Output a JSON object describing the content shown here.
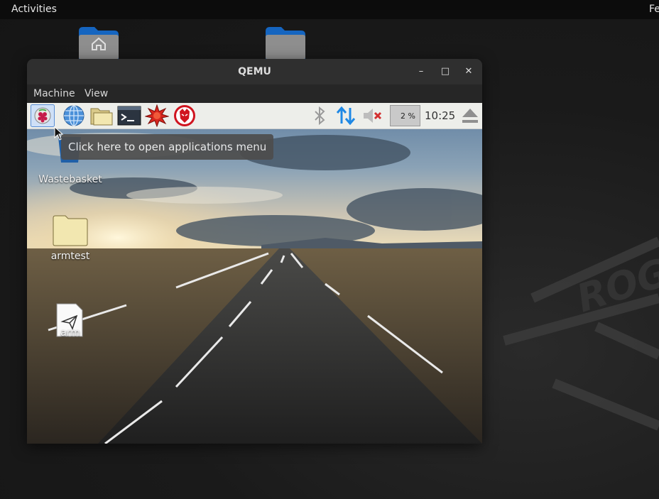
{
  "host": {
    "topbar": {
      "activities": "Activities",
      "clock": "Fe"
    },
    "folders": [
      {
        "name": "home-folder-icon"
      },
      {
        "name": "folder-icon"
      }
    ]
  },
  "qemu": {
    "title": "QEMU",
    "menu": [
      "Machine",
      "View"
    ],
    "controls": {
      "minimize": "–",
      "maximize": "□",
      "close": "✕"
    }
  },
  "guest": {
    "panel": {
      "launchers": [
        "raspberry-menu",
        "web-browser",
        "file-manager",
        "terminal",
        "mathematica",
        "wolfram"
      ],
      "cpu_percent": "2 %",
      "clock": "10:25"
    },
    "tooltip": "Click here to open applications menu",
    "desktop_icons": [
      {
        "label": "Wastebasket"
      },
      {
        "label": "armtest"
      },
      {
        "label": "arm"
      }
    ]
  },
  "colors": {
    "accent_blue": "#1e88e5",
    "panel_bg": "#edeeea",
    "folder_yellow": "#f2e7b0"
  }
}
